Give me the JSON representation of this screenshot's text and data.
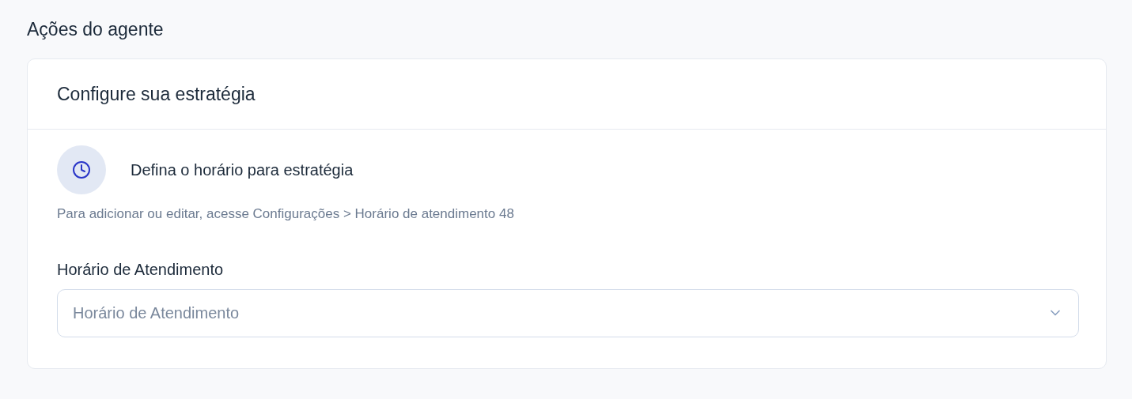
{
  "page": {
    "title": "Ações do agente"
  },
  "card": {
    "title": "Configure sua estratégia",
    "schedule": {
      "heading": "Defina o horário para estratégia",
      "hint": "Para adicionar ou editar, acesse Configurações > Horário de atendimento 48"
    },
    "field": {
      "label": "Horário de Atendimento",
      "placeholder": "Horário de Atendimento"
    }
  }
}
